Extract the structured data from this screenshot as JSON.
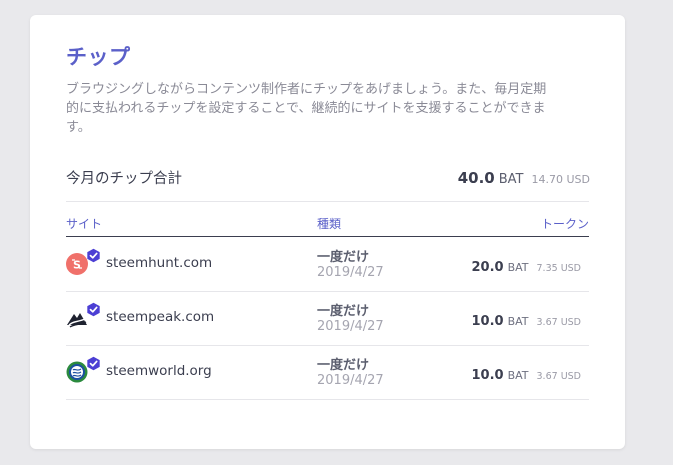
{
  "card": {
    "title": "チップ",
    "description": "ブラウジングしながらコンテンツ制作者にチップをあげましょう。また、毎月定期的に支払われるチップを設定することで、継続的にサイトを支援することができます。"
  },
  "summary": {
    "label": "今月のチップ合計",
    "amount": "40.0",
    "unit": "BAT",
    "usd": "14.70 USD"
  },
  "table": {
    "headers": {
      "site": "サイト",
      "type": "種類",
      "token": "トークン"
    },
    "rows": [
      {
        "site": "steemhunt.com",
        "icon": "steemhunt-favicon",
        "type": "一度だけ",
        "date": "2019/4/27",
        "amount": "20.0",
        "unit": "BAT",
        "usd": "7.35 USD"
      },
      {
        "site": "steempeak.com",
        "icon": "steempeak-favicon",
        "type": "一度だけ",
        "date": "2019/4/27",
        "amount": "10.0",
        "unit": "BAT",
        "usd": "3.67 USD"
      },
      {
        "site": "steemworld.org",
        "icon": "steemworld-favicon",
        "type": "一度だけ",
        "date": "2019/4/27",
        "amount": "10.0",
        "unit": "BAT",
        "usd": "3.67 USD"
      }
    ]
  },
  "colors": {
    "accent": "#5b60c9",
    "verified_badge": "#4c3fd4",
    "text_dark": "#3b3e4f",
    "text_muted": "#9a9aa6"
  }
}
